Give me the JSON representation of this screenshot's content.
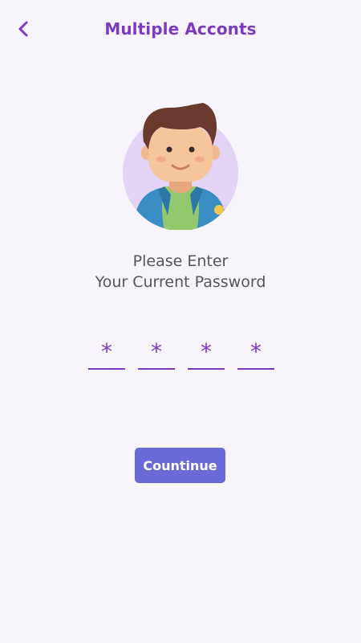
{
  "header": {
    "title": "Multiple Acconts",
    "back_icon": "chevron-left-icon"
  },
  "colors": {
    "accent": "#7b3bbf",
    "button": "#6b69d8",
    "background": "#f7f5fb",
    "avatar_circle": "#e3d3f4"
  },
  "prompt": {
    "line1": "Please Enter",
    "line2": "Your Current Password"
  },
  "pin": {
    "digits": [
      "*",
      "*",
      "*",
      "*"
    ]
  },
  "continue_label": "Countinue"
}
